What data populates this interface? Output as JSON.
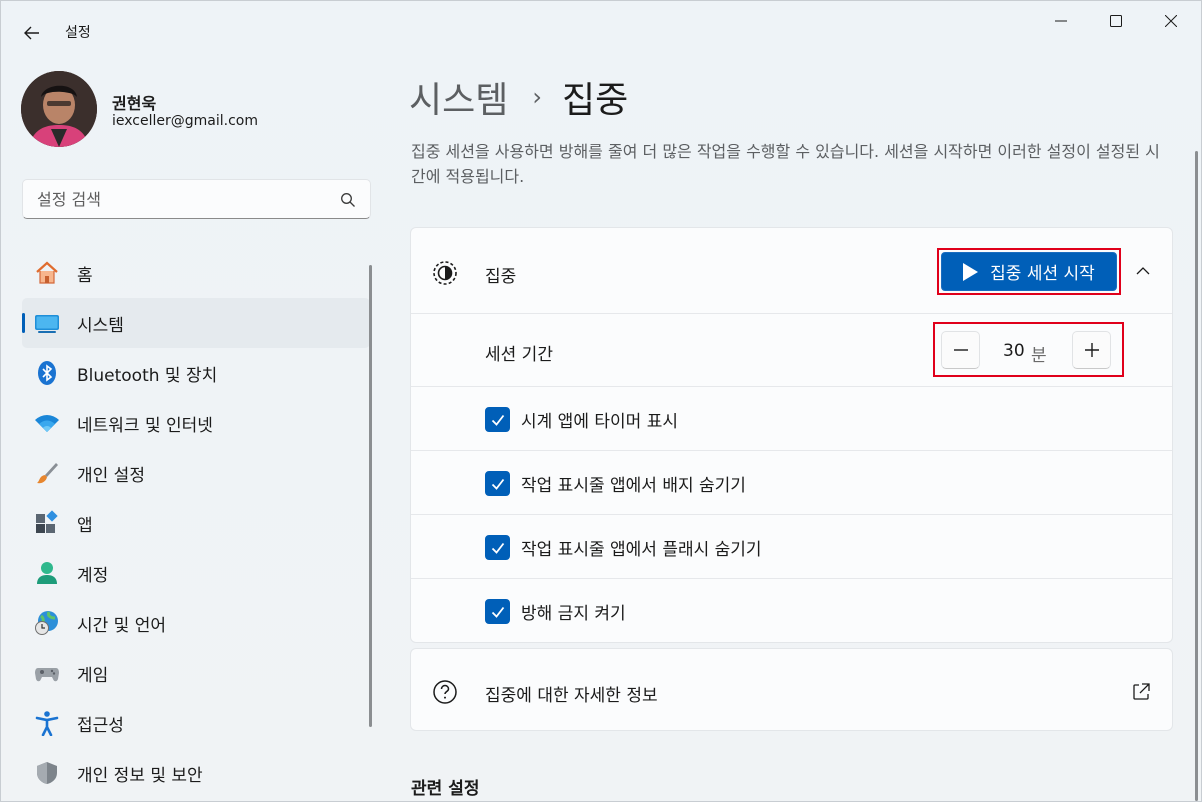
{
  "window": {
    "title": "설정",
    "controls": [
      "minimize-icon",
      "maximize-icon",
      "close-icon"
    ]
  },
  "profile": {
    "name": "권현욱",
    "email": "iexceller@gmail.com"
  },
  "search": {
    "placeholder": "설정 검색",
    "value": ""
  },
  "sidebar": {
    "items": [
      {
        "label": "홈",
        "icon": "home-icon"
      },
      {
        "label": "시스템",
        "icon": "system-icon",
        "active": true
      },
      {
        "label": "Bluetooth 및 장치",
        "icon": "bluetooth-icon"
      },
      {
        "label": "네트워크 및 인터넷",
        "icon": "wifi-icon"
      },
      {
        "label": "개인 설정",
        "icon": "brush-icon"
      },
      {
        "label": "앱",
        "icon": "apps-icon"
      },
      {
        "label": "계정",
        "icon": "account-icon"
      },
      {
        "label": "시간 및 언어",
        "icon": "globe-clock-icon"
      },
      {
        "label": "게임",
        "icon": "gamepad-icon"
      },
      {
        "label": "접근성",
        "icon": "accessibility-icon"
      },
      {
        "label": "개인 정보 및 보안",
        "icon": "shield-icon"
      }
    ]
  },
  "breadcrumb": {
    "parent": "시스템",
    "separator": "›",
    "current": "집중"
  },
  "description": "집중 세션을 사용하면 방해를 줄여 더 많은 작업을 수행할 수 있습니다. 세션을 시작하면 이러한 설정이 설정된 시간에 적용됩니다.",
  "focus_card": {
    "label": "집중",
    "start_button": "집중 세션 시작",
    "duration": {
      "label": "세션 기간",
      "value": "30",
      "unit": "분"
    },
    "options": [
      {
        "label": "시계 앱에 타이머 표시",
        "checked": true
      },
      {
        "label": "작업 표시줄 앱에서 배지 숨기기",
        "checked": true
      },
      {
        "label": "작업 표시줄 앱에서 플래시 숨기기",
        "checked": true
      },
      {
        "label": "방해 금지 켜기",
        "checked": true
      }
    ]
  },
  "info_card": {
    "label": "집중에 대한 자세한 정보"
  },
  "related_settings": "관련 설정",
  "colors": {
    "accent": "#005fb8",
    "highlight_outline": "#e0001b"
  }
}
